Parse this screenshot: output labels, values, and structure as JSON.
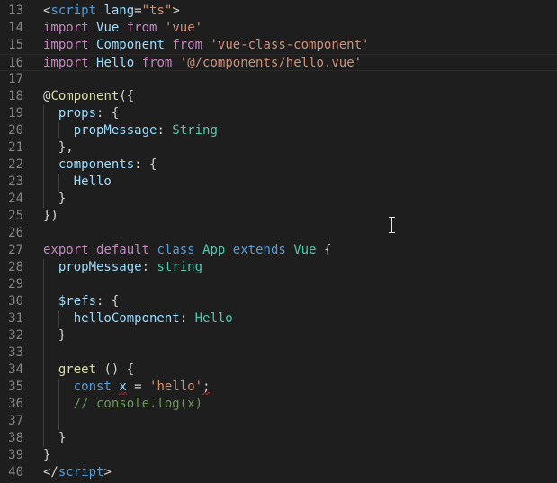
{
  "colors": {
    "background": "#1e1e1e",
    "gutter_text": "#858585",
    "default": "#d4d4d4",
    "tag": "#569cd6",
    "attribute": "#9cdcfe",
    "string": "#ce9178",
    "keyword_control": "#c586c0",
    "storage": "#569cd6",
    "type": "#4ec9b0",
    "function": "#dcdcaa",
    "variable": "#9cdcfe",
    "comment": "#6a9955",
    "error_squiggle": "#f14c4c"
  },
  "editor": {
    "current_line": 16,
    "lines": [
      {
        "num": "13",
        "indent": 0,
        "tokens": [
          {
            "t": "<",
            "c": "default"
          },
          {
            "t": "script",
            "c": "tag"
          },
          {
            "t": " ",
            "c": "default"
          },
          {
            "t": "lang",
            "c": "attribute"
          },
          {
            "t": "=",
            "c": "default"
          },
          {
            "t": "\"ts\"",
            "c": "string"
          },
          {
            "t": ">",
            "c": "default"
          }
        ]
      },
      {
        "num": "14",
        "indent": 0,
        "tokens": [
          {
            "t": "import",
            "c": "keyword_control"
          },
          {
            "t": " ",
            "c": "default"
          },
          {
            "t": "Vue",
            "c": "variable"
          },
          {
            "t": " ",
            "c": "default"
          },
          {
            "t": "from",
            "c": "keyword_control"
          },
          {
            "t": " ",
            "c": "default"
          },
          {
            "t": "'vue'",
            "c": "string"
          }
        ]
      },
      {
        "num": "15",
        "indent": 0,
        "tokens": [
          {
            "t": "import",
            "c": "keyword_control"
          },
          {
            "t": " ",
            "c": "default"
          },
          {
            "t": "Component",
            "c": "variable"
          },
          {
            "t": " ",
            "c": "default"
          },
          {
            "t": "from",
            "c": "keyword_control"
          },
          {
            "t": " ",
            "c": "default"
          },
          {
            "t": "'vue-class-component'",
            "c": "string"
          }
        ]
      },
      {
        "num": "16",
        "indent": 0,
        "tokens": [
          {
            "t": "import",
            "c": "keyword_control"
          },
          {
            "t": " ",
            "c": "default"
          },
          {
            "t": "Hello",
            "c": "variable"
          },
          {
            "t": " ",
            "c": "default"
          },
          {
            "t": "from",
            "c": "keyword_control"
          },
          {
            "t": " ",
            "c": "default"
          },
          {
            "t": "'@/components/hello.vue'",
            "c": "string"
          }
        ]
      },
      {
        "num": "17",
        "indent": 0,
        "tokens": []
      },
      {
        "num": "18",
        "indent": 0,
        "tokens": [
          {
            "t": "@",
            "c": "default"
          },
          {
            "t": "Component",
            "c": "function"
          },
          {
            "t": "({",
            "c": "default"
          }
        ]
      },
      {
        "num": "19",
        "indent": 1,
        "tokens": [
          {
            "t": "  ",
            "c": "default"
          },
          {
            "t": "props",
            "c": "variable"
          },
          {
            "t": ": {",
            "c": "default"
          }
        ]
      },
      {
        "num": "20",
        "indent": 2,
        "tokens": [
          {
            "t": "    ",
            "c": "default"
          },
          {
            "t": "propMessage",
            "c": "variable"
          },
          {
            "t": ": ",
            "c": "default"
          },
          {
            "t": "String",
            "c": "type"
          }
        ]
      },
      {
        "num": "21",
        "indent": 1,
        "tokens": [
          {
            "t": "  },",
            "c": "default"
          }
        ]
      },
      {
        "num": "22",
        "indent": 1,
        "tokens": [
          {
            "t": "  ",
            "c": "default"
          },
          {
            "t": "components",
            "c": "variable"
          },
          {
            "t": ": {",
            "c": "default"
          }
        ]
      },
      {
        "num": "23",
        "indent": 2,
        "tokens": [
          {
            "t": "    ",
            "c": "default"
          },
          {
            "t": "Hello",
            "c": "variable"
          }
        ]
      },
      {
        "num": "24",
        "indent": 1,
        "tokens": [
          {
            "t": "  }",
            "c": "default"
          }
        ]
      },
      {
        "num": "25",
        "indent": 0,
        "tokens": [
          {
            "t": "})",
            "c": "default"
          }
        ]
      },
      {
        "num": "26",
        "indent": 0,
        "tokens": []
      },
      {
        "num": "27",
        "indent": 0,
        "tokens": [
          {
            "t": "export",
            "c": "keyword_control"
          },
          {
            "t": " ",
            "c": "default"
          },
          {
            "t": "default",
            "c": "keyword_control"
          },
          {
            "t": " ",
            "c": "default"
          },
          {
            "t": "class",
            "c": "storage"
          },
          {
            "t": " ",
            "c": "default"
          },
          {
            "t": "App",
            "c": "type"
          },
          {
            "t": " ",
            "c": "default"
          },
          {
            "t": "extends",
            "c": "storage"
          },
          {
            "t": " ",
            "c": "default"
          },
          {
            "t": "Vue",
            "c": "type"
          },
          {
            "t": " {",
            "c": "default"
          }
        ]
      },
      {
        "num": "28",
        "indent": 1,
        "tokens": [
          {
            "t": "  ",
            "c": "default"
          },
          {
            "t": "propMessage",
            "c": "variable"
          },
          {
            "t": ": ",
            "c": "default"
          },
          {
            "t": "string",
            "c": "type"
          }
        ]
      },
      {
        "num": "29",
        "indent": 1,
        "tokens": []
      },
      {
        "num": "30",
        "indent": 1,
        "tokens": [
          {
            "t": "  ",
            "c": "default"
          },
          {
            "t": "$refs",
            "c": "variable"
          },
          {
            "t": ": {",
            "c": "default"
          }
        ]
      },
      {
        "num": "31",
        "indent": 2,
        "tokens": [
          {
            "t": "    ",
            "c": "default"
          },
          {
            "t": "helloComponent",
            "c": "variable"
          },
          {
            "t": ": ",
            "c": "default"
          },
          {
            "t": "Hello",
            "c": "type"
          }
        ]
      },
      {
        "num": "32",
        "indent": 1,
        "tokens": [
          {
            "t": "  }",
            "c": "default"
          }
        ]
      },
      {
        "num": "33",
        "indent": 1,
        "tokens": []
      },
      {
        "num": "34",
        "indent": 1,
        "tokens": [
          {
            "t": "  ",
            "c": "default"
          },
          {
            "t": "greet",
            "c": "function"
          },
          {
            "t": " () {",
            "c": "default"
          }
        ]
      },
      {
        "num": "35",
        "indent": 2,
        "tokens": [
          {
            "t": "    ",
            "c": "default"
          },
          {
            "t": "const",
            "c": "storage"
          },
          {
            "t": " ",
            "c": "default"
          },
          {
            "t": "x",
            "c": "variable",
            "err": true
          },
          {
            "t": " = ",
            "c": "default"
          },
          {
            "t": "'hello'",
            "c": "string"
          },
          {
            "t": ";",
            "c": "default",
            "err": true
          }
        ]
      },
      {
        "num": "36",
        "indent": 2,
        "tokens": [
          {
            "t": "    ",
            "c": "default"
          },
          {
            "t": "// console.log(x)",
            "c": "comment"
          }
        ]
      },
      {
        "num": "37",
        "indent": 2,
        "tokens": []
      },
      {
        "num": "38",
        "indent": 1,
        "tokens": [
          {
            "t": "  }",
            "c": "default"
          }
        ]
      },
      {
        "num": "39",
        "indent": 0,
        "tokens": [
          {
            "t": "}",
            "c": "default"
          }
        ]
      },
      {
        "num": "40",
        "indent": 0,
        "tokens": [
          {
            "t": "</",
            "c": "default"
          },
          {
            "t": "script",
            "c": "tag"
          },
          {
            "t": ">",
            "c": "default"
          }
        ]
      }
    ]
  }
}
